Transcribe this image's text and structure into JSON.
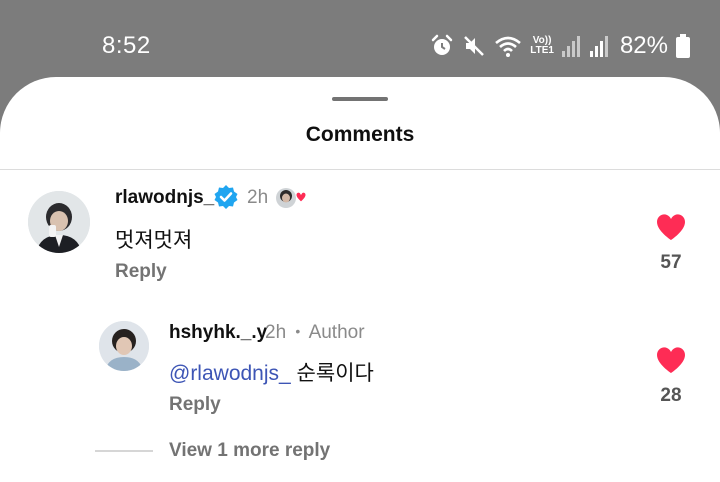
{
  "status_bar": {
    "time": "8:52",
    "battery_percent": "82%",
    "network_label_top": "Vo))",
    "network_label_bottom": "LTE1",
    "icons": [
      "alarm-icon",
      "mute-icon",
      "wifi-icon",
      "signal-icon",
      "signal-icon",
      "battery-icon"
    ]
  },
  "sheet": {
    "title": "Comments"
  },
  "comments": [
    {
      "username": "rlawodnjs_",
      "verified": true,
      "time": "2h",
      "text": "멋져멋져",
      "reply_label": "Reply",
      "likes": "57",
      "liked_by_author": true
    }
  ],
  "replies": [
    {
      "username": "hshyhk._.y",
      "time": "2h",
      "separator": "•",
      "role": "Author",
      "mention": "@rlawodnjs_",
      "text": " 순록이다",
      "reply_label": "Reply",
      "likes": "28"
    }
  ],
  "view_more_replies": "View 1 more reply",
  "colors": {
    "like_red": "#fe2c55",
    "verified_blue": "#20a5f0",
    "mention_blue": "#3d55b5"
  }
}
